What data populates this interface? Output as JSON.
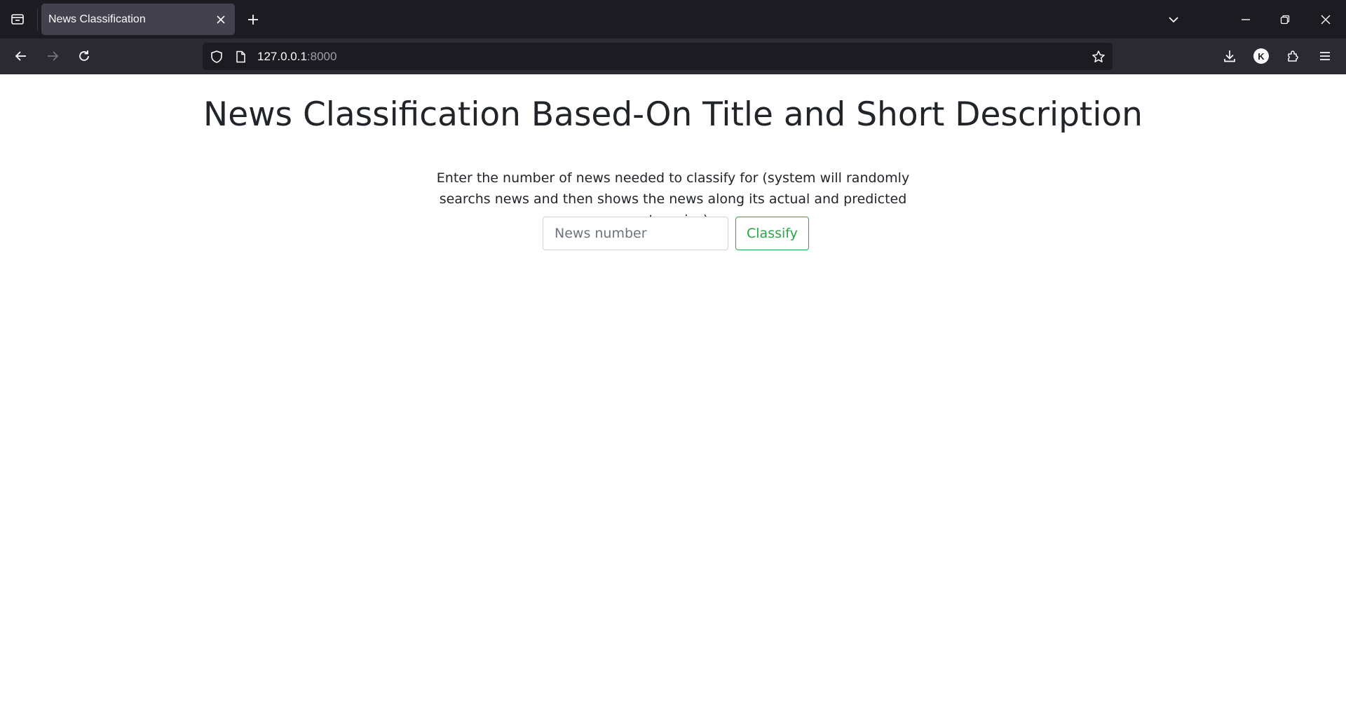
{
  "browser": {
    "tab": {
      "title": "News Classification"
    },
    "url": {
      "host": "127.0.0.1",
      "port": ":8000"
    },
    "profile_initial": "K",
    "colors": {
      "tabstrip_bg": "#1c1b22",
      "toolbar_bg": "#2b2a33",
      "active_tab_bg": "#42414d"
    }
  },
  "page": {
    "title": "News Classification Based-On Title and Short Description",
    "description": "Enter the number of news needed to classify for (system will randomly searchs news and then shows the news along its actual and predicted categories).",
    "form": {
      "input_placeholder": "News number",
      "input_value": "",
      "button_label": "Classify"
    },
    "colors": {
      "accent": "#28a745",
      "text": "#212529"
    }
  }
}
